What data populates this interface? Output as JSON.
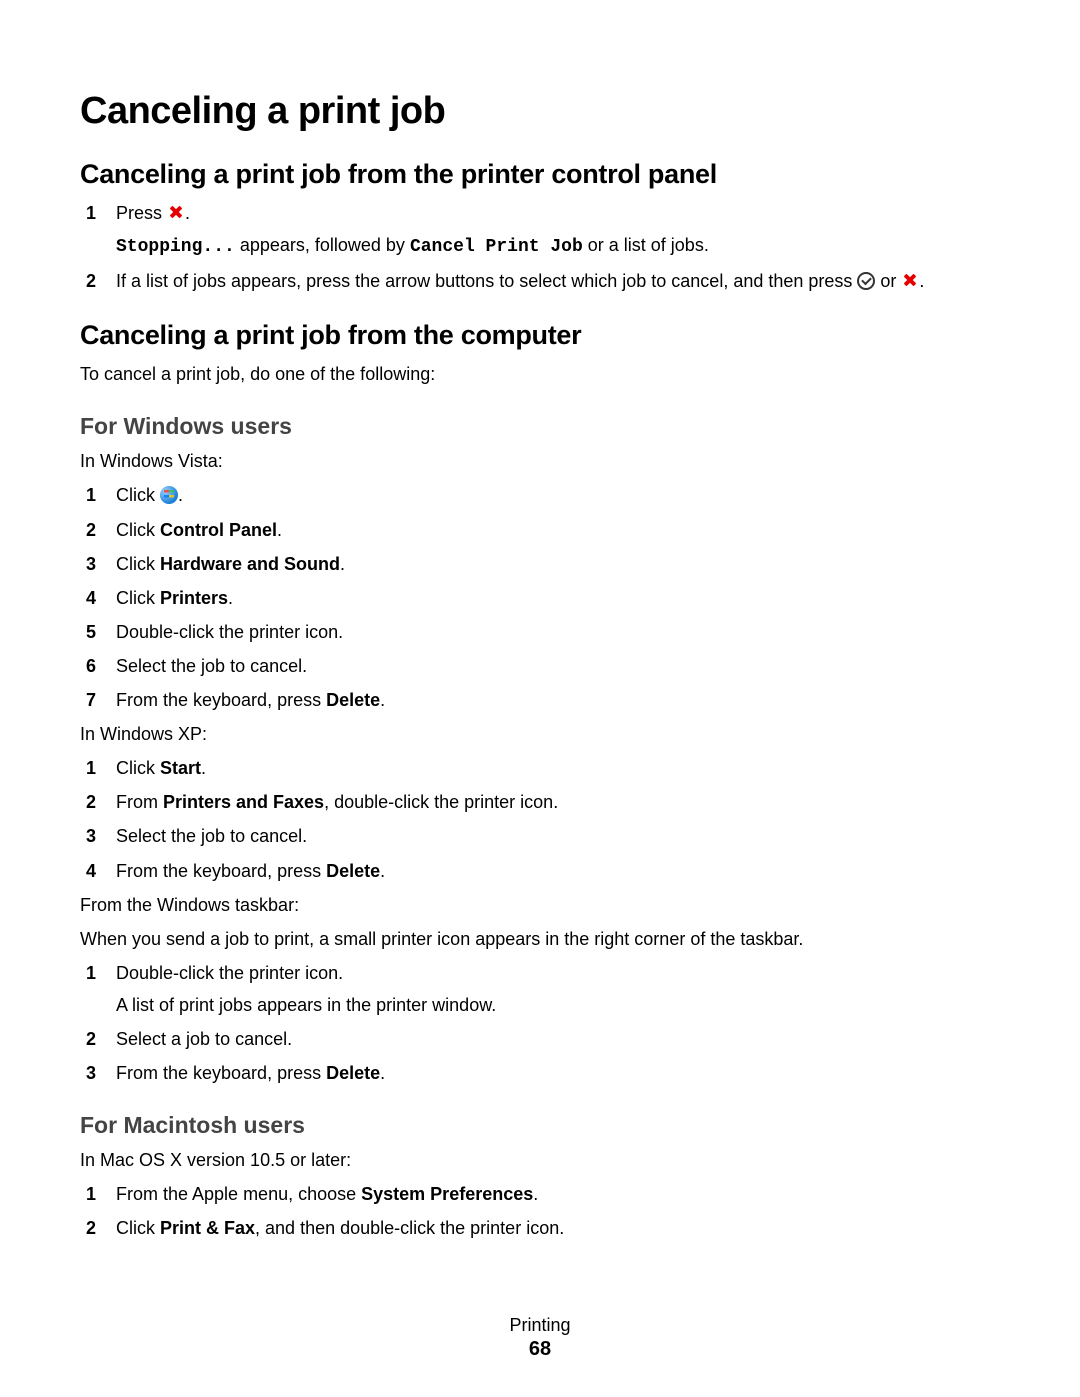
{
  "title": "Canceling a print job",
  "section_control_panel": {
    "heading": "Canceling a print job from the printer control panel",
    "steps": [
      {
        "text_before": "Press ",
        "text_after": ".",
        "sub_before": "",
        "code1": "Stopping...",
        "sub_mid": " appears, followed by ",
        "code2": "Cancel Print Job",
        "sub_after": " or a list of jobs."
      },
      {
        "text_before": "If a list of jobs appears, press the arrow buttons to select which job to cancel, and then press ",
        "text_mid": " or ",
        "text_after": "."
      }
    ]
  },
  "section_computer": {
    "heading": "Canceling a print job from the computer",
    "intro": "To cancel a print job, do one of the following:"
  },
  "windows": {
    "heading": "For Windows users",
    "vista_label": "In Windows Vista:",
    "vista_steps": [
      {
        "before": "Click ",
        "after": "."
      },
      {
        "before": "Click ",
        "bold": "Control Panel",
        "after": "."
      },
      {
        "before": "Click ",
        "bold": "Hardware and Sound",
        "after": "."
      },
      {
        "before": "Click ",
        "bold": "Printers",
        "after": "."
      },
      {
        "before": "Double-click the printer icon."
      },
      {
        "before": "Select the job to cancel."
      },
      {
        "before": "From the keyboard, press ",
        "bold": "Delete",
        "after": "."
      }
    ],
    "xp_label": "In Windows XP:",
    "xp_steps": [
      {
        "before": "Click ",
        "bold": "Start",
        "after": "."
      },
      {
        "before": "From ",
        "bold": "Printers and Faxes",
        "after": ", double-click the printer icon."
      },
      {
        "before": "Select the job to cancel."
      },
      {
        "before": "From the keyboard, press ",
        "bold": "Delete",
        "after": "."
      }
    ],
    "taskbar_label": "From the Windows taskbar:",
    "taskbar_intro": "When you send a job to print, a small printer icon appears in the right corner of the taskbar.",
    "taskbar_steps": [
      {
        "before": "Double-click the printer icon.",
        "sub": "A list of print jobs appears in the printer window."
      },
      {
        "before": "Select a job to cancel."
      },
      {
        "before": "From the keyboard, press ",
        "bold": "Delete",
        "after": "."
      }
    ]
  },
  "mac": {
    "heading": "For Macintosh users",
    "intro": "In Mac OS X version 10.5 or later:",
    "steps": [
      {
        "before": "From the Apple menu, choose ",
        "bold": "System Preferences",
        "after": "."
      },
      {
        "before": "Click ",
        "bold": "Print & Fax",
        "after": ", and then double-click the printer icon."
      }
    ]
  },
  "footer": {
    "section": "Printing",
    "page": "68"
  }
}
